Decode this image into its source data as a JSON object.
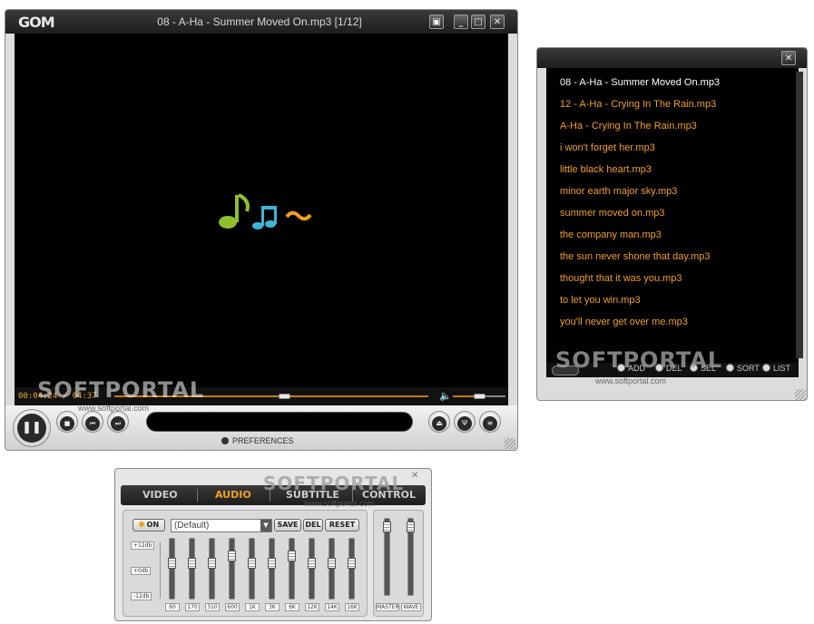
{
  "player": {
    "logo": "GOM",
    "title": "08 - A-Ha - Summer Moved On.mp3  [1/12]",
    "time": "00:04:24 / 04:37",
    "preferences_label": "PREFERENCES",
    "seek_progress": 0.54,
    "volume_level": 0.5
  },
  "playlist": {
    "items": [
      "08 - A-Ha - Summer Moved On.mp3",
      "12 - A-Ha - Crying In The Rain.mp3",
      "A-Ha - Crying In The Rain.mp3",
      "i won't forget her.mp3",
      "little black heart.mp3",
      "minor earth major sky.mp3",
      "summer moved on.mp3",
      "the company man.mp3",
      "the sun never shone that day.mp3",
      "thought that it was you.mp3",
      "to let you win.mp3",
      "you'll never get over me.mp3"
    ],
    "current_index": 0,
    "options": [
      "ADD",
      "DEL",
      "SEL",
      "SORT",
      "LIST"
    ]
  },
  "control_panel": {
    "tabs": [
      "VIDEO",
      "AUDIO",
      "SUBTITLE",
      "CONTROL"
    ],
    "active_tab": "AUDIO",
    "on_label": "ON",
    "preset": "(Default)",
    "save_label": "SAVE",
    "del_label": "DEL",
    "reset_label": "RESET",
    "db_labels": [
      "+12db",
      "+0db",
      "-12db"
    ],
    "bands": [
      "60",
      "170",
      "310",
      "600",
      "1K",
      "3K",
      "6K",
      "12K",
      "14K",
      "16K"
    ],
    "master_label": "MASTER",
    "wave_label": "WAVE"
  },
  "watermark": {
    "text": "SOFTPORTAL",
    "url": "www.softportal.com"
  },
  "colors": {
    "accent": "#f0a020",
    "titlebar": "#262626",
    "video_bg": "#000000"
  }
}
